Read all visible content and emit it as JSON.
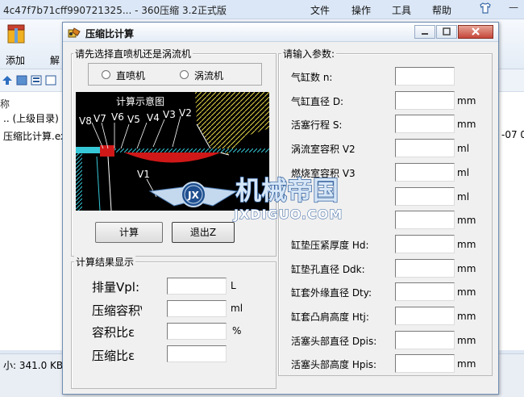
{
  "background_app": {
    "title": "4c47f7b71cff990721325... - 360压缩 3.2正式版",
    "menu": [
      "文件",
      "操作",
      "工具",
      "帮助"
    ],
    "toolbar": {
      "add_label": "添加",
      "extract_label": "解"
    },
    "list": {
      "column_name": "称",
      "rows": [
        {
          "name": ".. (上级目录)"
        },
        {
          "name": "压缩比计算.exe",
          "date": "-07 0"
        }
      ]
    },
    "status": "小: 341.0 KB 共"
  },
  "dialog": {
    "title": "压缩比计算",
    "mode_group": {
      "title": "请先选择直喷机还是涡流机",
      "options": [
        "直喷机",
        "涡流机"
      ]
    },
    "diagram": {
      "caption": "计算示意图",
      "labels": [
        "V8",
        "V7",
        "V6",
        "V5",
        "V4",
        "V3",
        "V2",
        "V1"
      ]
    },
    "buttons": {
      "calculate": "计算",
      "exit": "退出Z"
    },
    "results_group": {
      "title": "计算结果显示",
      "rows": [
        {
          "label": "排量Vpl:",
          "unit": "L"
        },
        {
          "label": "压缩容积\\",
          "unit": "ml"
        },
        {
          "label": "容积比ε",
          "unit": "%"
        },
        {
          "label": "压缩比ε",
          "unit": ""
        }
      ]
    },
    "params_group": {
      "title": "请输入参数:",
      "rows": [
        {
          "label": "气缸数 n:",
          "unit": ""
        },
        {
          "label": "气缸直径 D:",
          "unit": "mm"
        },
        {
          "label": "活塞行程 S:",
          "unit": "mm"
        },
        {
          "label": "涡流室容积 V2",
          "unit": "ml"
        },
        {
          "label": "燃烧室容积 V3",
          "unit": "ml"
        },
        {
          "label": "",
          "unit": "ml"
        },
        {
          "label": "",
          "unit": "mm"
        },
        {
          "label": "缸垫压紧厚度 Hd:",
          "unit": "mm"
        },
        {
          "label": "缸垫孔直径 Ddk:",
          "unit": "mm"
        },
        {
          "label": "缸套外缘直径 Dty:",
          "unit": "mm"
        },
        {
          "label": "缸套凸肩高度 Htj:",
          "unit": "mm"
        },
        {
          "label": "活塞头部直径 Dpis:",
          "unit": "mm"
        },
        {
          "label": "活塞头部高度 Hpis:",
          "unit": "mm"
        }
      ]
    }
  },
  "watermark": {
    "text": "机械帝国",
    "sub": "JXDIGUO.COM",
    "badge": "JX"
  },
  "colors": {
    "accent": "#2f6fc0",
    "diagram_bg": "#000000",
    "watermark": "#c5d9ee"
  },
  "icons": [
    "archive-add-icon",
    "calculator-app-icon",
    "tshirt-skin-icon",
    "radio-icon"
  ]
}
